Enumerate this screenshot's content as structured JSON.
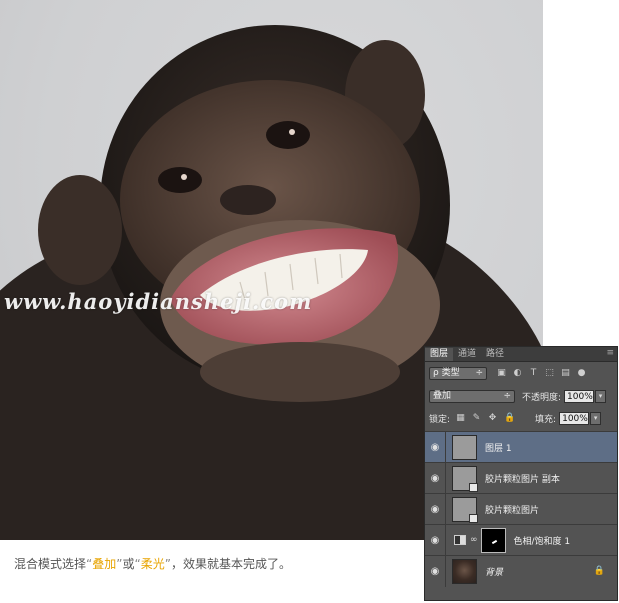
{
  "watermark": "www.haoyidiansheji.com",
  "caption": {
    "part1": "混合模式选择",
    "quote_open_1": "“",
    "highlight1": "叠加",
    "quote_close_1": "”",
    "part2": "或",
    "quote_open_2": "“",
    "highlight2": "柔光",
    "quote_close_2": "”",
    "part3": "，效果就基本完成了。"
  },
  "panel": {
    "tabs": [
      "图层",
      "通道",
      "路径"
    ],
    "active_tab": "图层",
    "filter_label": "ρ 类型",
    "filter_arrow": "÷",
    "blend_mode": "叠加",
    "blend_arrow": "÷",
    "opacity_label": "不透明度:",
    "opacity_value": "100%",
    "lock_label": "锁定:",
    "fill_label": "填充:",
    "fill_value": "100%",
    "menu_icon": "≡",
    "layers": [
      {
        "name": "图层 1",
        "selected": true,
        "thumb": "grey"
      },
      {
        "name": "胶片颗粒图片 副本",
        "selected": false,
        "thumb": "grey-smart"
      },
      {
        "name": "胶片颗粒图片",
        "selected": false,
        "thumb": "grey-smart"
      },
      {
        "name": "色相/饱和度 1",
        "selected": false,
        "thumb": "adjustment-mask"
      },
      {
        "name": "背景",
        "selected": false,
        "thumb": "photo-locked"
      }
    ]
  },
  "colors": {
    "highlight": "#e8a400",
    "panel_bg": "#535353",
    "selected_layer": "#5e6e86"
  }
}
